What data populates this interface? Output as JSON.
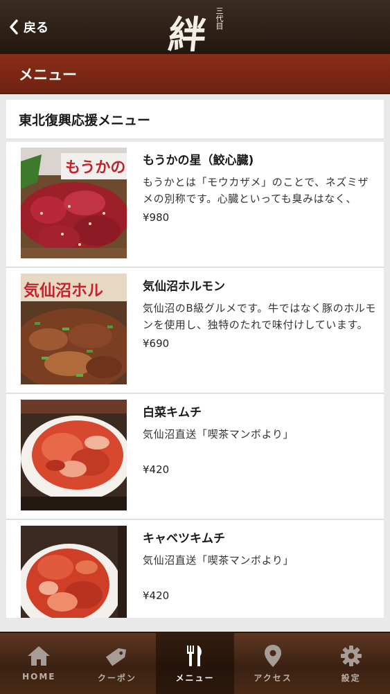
{
  "header": {
    "back_label": "戻る",
    "logo_text": "絆",
    "logo_sub": "三代目"
  },
  "section": {
    "title": "メニュー"
  },
  "category": {
    "title": "東北復興応援メニュー"
  },
  "items": [
    {
      "name": "もうかの星（鮫心臓)",
      "description": "もうかとは「モウカザメ」のことで、ネズミザメの別称です。心臓といっても臭みはなく、",
      "price": "¥980",
      "thumb_caption": "もうかの"
    },
    {
      "name": "気仙沼ホルモン",
      "description": "気仙沼のB級グルメです。牛ではなく豚のホルモンを使用し、独特のたれで味付けしています。",
      "price": "¥690",
      "thumb_caption": "気仙沼ホル"
    },
    {
      "name": "白菜キムチ",
      "description": "気仙沼直送「喫茶マンボより」",
      "price": "¥420"
    },
    {
      "name": "キャベツキムチ",
      "description": "気仙沼直送「喫茶マンボより」",
      "price": "¥420"
    }
  ],
  "tabs": [
    {
      "label": "HOME",
      "icon": "home-icon",
      "active": false
    },
    {
      "label": "クーポン",
      "icon": "coupon-tag-icon",
      "active": false
    },
    {
      "label": "メニュー",
      "icon": "fork-knife-icon",
      "active": true
    },
    {
      "label": "アクセス",
      "icon": "map-pin-icon",
      "active": false
    },
    {
      "label": "設定",
      "icon": "gear-icon",
      "active": false
    }
  ],
  "colors": {
    "header_bg": "#2d2018",
    "section_bar": "#7a2814",
    "tabbar_bg": "#4a2a17"
  }
}
